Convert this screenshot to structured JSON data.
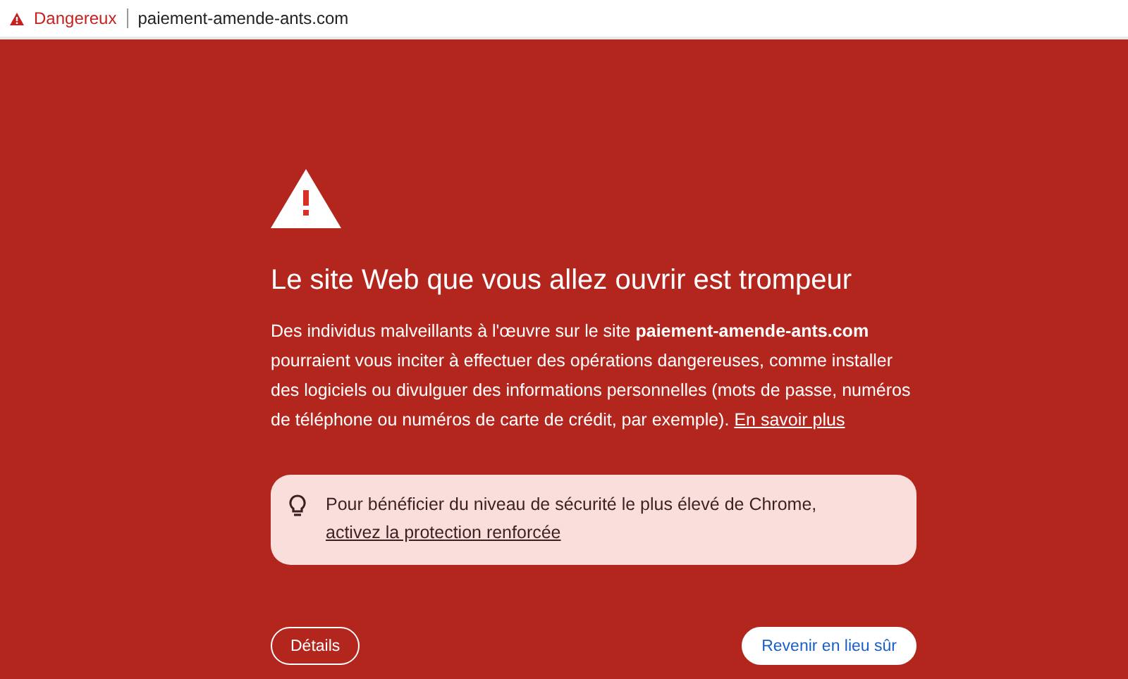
{
  "address_bar": {
    "security_label": "Dangereux",
    "url": "paiement-amende-ants.com"
  },
  "warning": {
    "heading": "Le site Web que vous allez ouvrir est trompeur",
    "paragraph": "Des individus malveillants à l'œuvre sur le site **paiement-amende-ants.com** pourraient vous inciter à effectuer des opérations dangereuses, comme installer des logiciels ou divulguer des informations personnelles (mots de passe, numéros de téléphone ou numéros de carte de crédit, par exemple).",
    "link": "En savoir plus"
  },
  "tip": {
    "text": "Pour bénéficier du niveau de sécurité le plus élevé de Chrome,",
    "link": "activez la protection renforcée"
  },
  "buttons": [
    {
      "kind": "outline",
      "label": "Détails"
    },
    {
      "kind": "filled",
      "label": "Revenir en lieu sûr"
    }
  ]
}
